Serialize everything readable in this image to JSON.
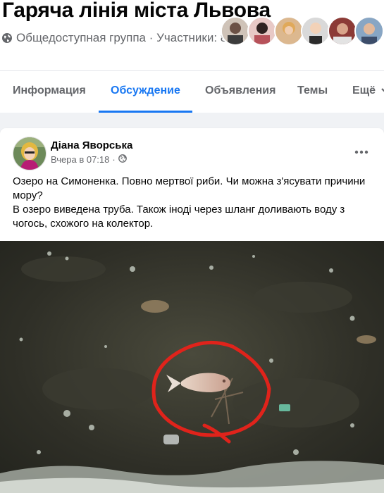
{
  "group": {
    "title": "Гаряча лінія міста Львова",
    "meta": "Общедоступная группа · Участники: 8"
  },
  "tabs": [
    {
      "label": "Информация"
    },
    {
      "label": "Обсуждение"
    },
    {
      "label": "Объявления"
    },
    {
      "label": "Темы"
    },
    {
      "label": "Ещё"
    }
  ],
  "post": {
    "author": "Діана Яворська",
    "time": "Вчера в 07:18",
    "text_line1": "Озеро на Симоненка. Повно мертвої риби. Чи можна з'ясувати причини мору?",
    "text_line2": "В озеро виведена труба. Також іноді через шланг доливають воду з чогось, схожого на колектор."
  },
  "colors": {
    "accent": "#1877f2",
    "secondary_text": "#65676b",
    "annotation": "#e0231b"
  },
  "icons": [
    "globe-icon",
    "chevron-down-icon",
    "more-icon",
    "public-icon"
  ]
}
